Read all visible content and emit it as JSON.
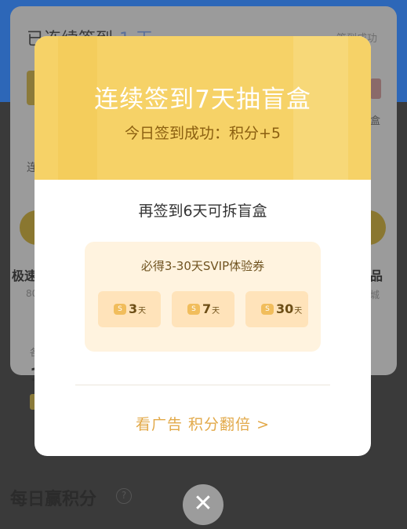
{
  "background": {
    "streak_text": "已连续签到",
    "streak_number": "1 天",
    "success_text": "签到成功",
    "right_char": "盒",
    "left_char": "连",
    "left_item_label": "极速",
    "left_item_sub": "80",
    "right_item_label": "品",
    "right_item_sub": "城",
    "left_small": "各",
    "left_big": "1",
    "section_title": "每日赢积分",
    "help_icon": "?"
  },
  "modal": {
    "title": "连续签到7天抽盲盒",
    "subtitle": "今日签到成功：积分+5",
    "body_text": "再签到6天可拆盲盒",
    "coupon_title": "必得3-30天SVIP体验券",
    "coupons": [
      {
        "value": "3",
        "unit": "天",
        "badge": "S"
      },
      {
        "value": "7",
        "unit": "天",
        "badge": "S"
      },
      {
        "value": "30",
        "unit": "天",
        "badge": "S"
      }
    ],
    "ad_link": "看广告 积分翻倍 >"
  },
  "close_button": {
    "label": "✕"
  },
  "colors": {
    "header": "#f6d267",
    "accent_text": "#e2a949",
    "coupon_bg": "#ffe3ba",
    "panel_bg": "#fff3df"
  }
}
